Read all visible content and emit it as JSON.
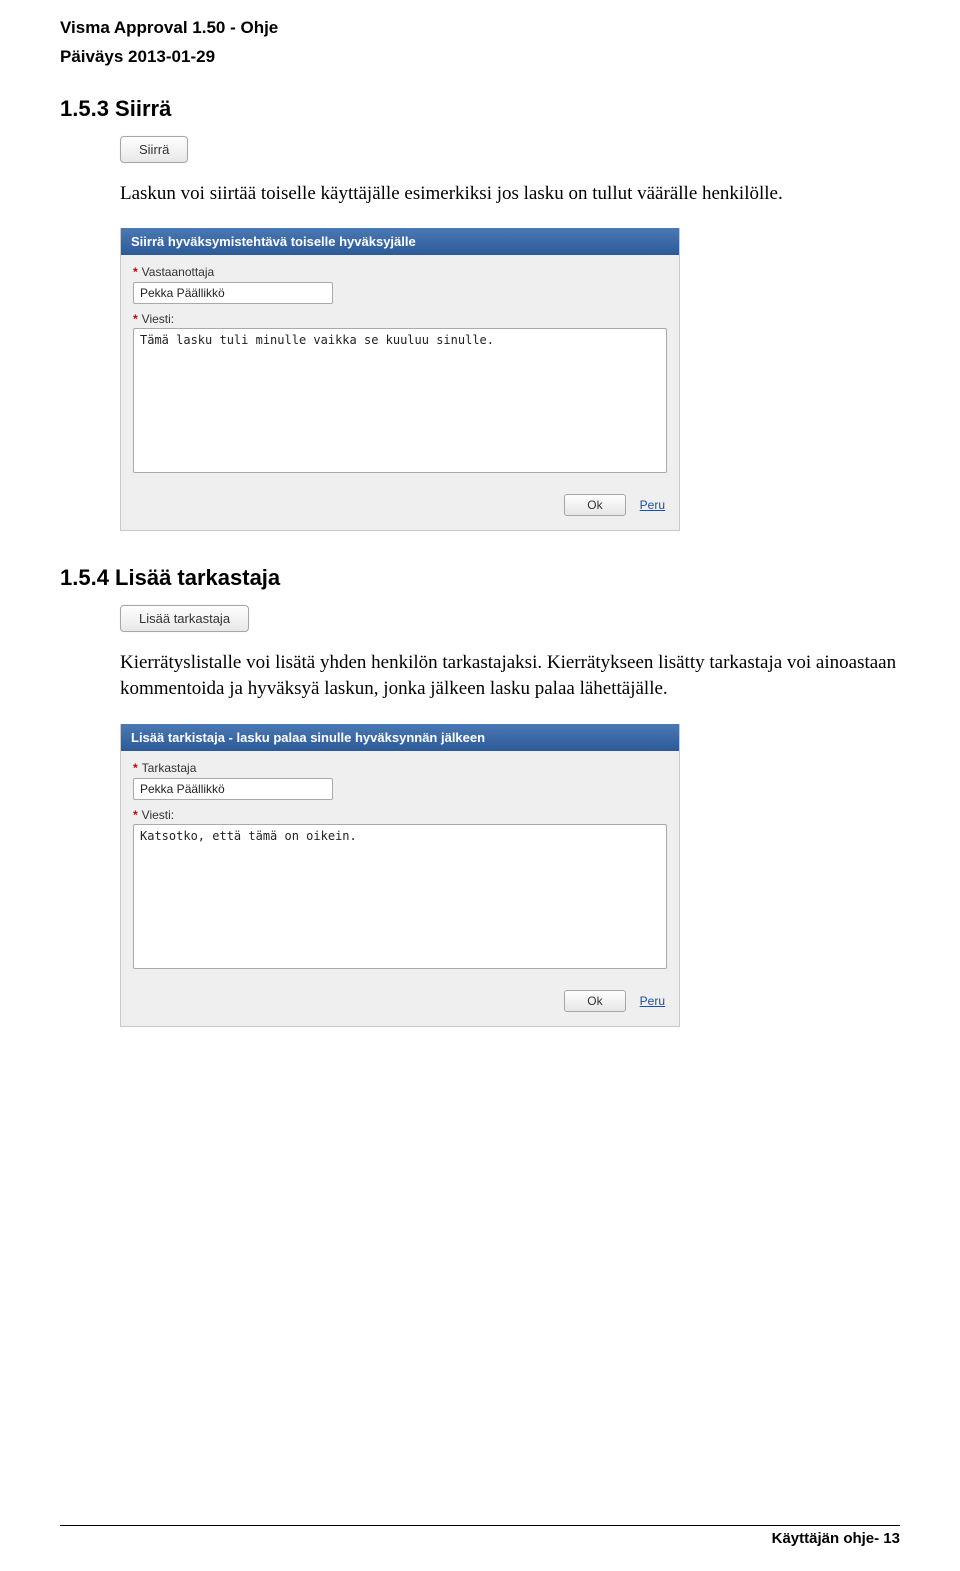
{
  "header": {
    "title": "Visma Approval 1.50 - Ohje",
    "date": "Päiväys 2013-01-29"
  },
  "section1": {
    "heading": "1.5.3  Siirrä",
    "button": "Siirrä",
    "paragraph": "Laskun voi siirtää toiselle käyttäjälle esimerkiksi jos lasku on tullut väärälle henkilölle."
  },
  "dialog1": {
    "title": "Siirrä hyväksymistehtävä toiselle hyväksyjälle",
    "recipient_label": "Vastaanottaja",
    "recipient_value": "Pekka Päällikkö",
    "message_label": "Viesti:",
    "message_value": "Tämä lasku tuli minulle vaikka se kuuluu sinulle.",
    "ok": "Ok",
    "cancel": "Peru"
  },
  "section2": {
    "heading": "1.5.4  Lisää tarkastaja",
    "button": "Lisää tarkastaja",
    "paragraph": "Kierrätyslistalle voi lisätä yhden henkilön tarkastajaksi. Kierrätykseen lisätty tarkastaja voi ainoastaan kommentoida ja hyväksyä laskun, jonka jälkeen lasku palaa lähettäjälle."
  },
  "dialog2": {
    "title": "Lisää tarkistaja - lasku palaa sinulle hyväksynnän jälkeen",
    "reviewer_label": "Tarkastaja",
    "reviewer_value": "Pekka Päällikkö",
    "message_label": "Viesti:",
    "message_value": "Katsotko, että tämä on oikein.",
    "ok": "Ok",
    "cancel": "Peru"
  },
  "footer": {
    "text": "Käyttäjän ohje- 13"
  }
}
